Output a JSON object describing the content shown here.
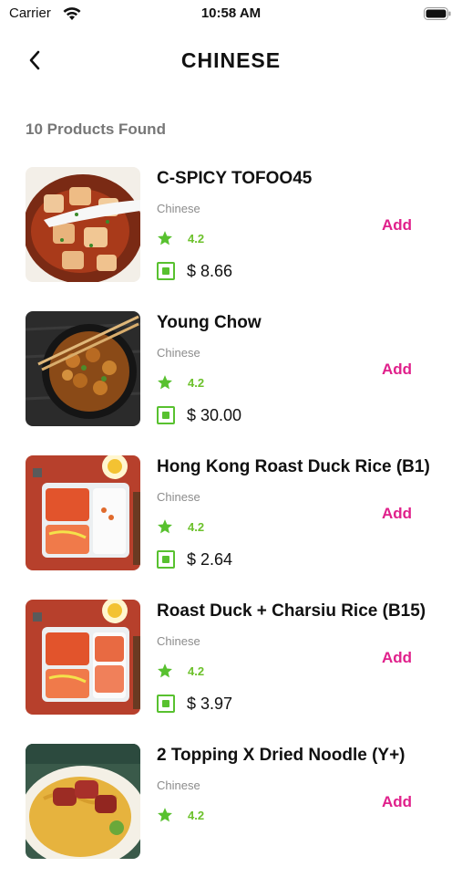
{
  "status_bar": {
    "carrier": "Carrier",
    "time": "10:58 AM"
  },
  "header": {
    "title": "CHINESE"
  },
  "results": {
    "count_text": "10 Products Found"
  },
  "products": [
    {
      "name": "C-SPICY TOFOO45",
      "category": "Chinese",
      "rating": "4.2",
      "price": "$ 8.66",
      "add_label": "Add"
    },
    {
      "name": "Young Chow",
      "category": "Chinese",
      "rating": "4.2",
      "price": "$ 30.00",
      "add_label": "Add"
    },
    {
      "name": "Hong Kong Roast Duck Rice (B1)",
      "category": "Chinese",
      "rating": "4.2",
      "price": "$ 2.64",
      "add_label": "Add"
    },
    {
      "name": "Roast Duck + Charsiu Rice (B15)",
      "category": "Chinese",
      "rating": "4.2",
      "price": "$ 3.97",
      "add_label": "Add"
    },
    {
      "name": "2 Topping X Dried Noodle (Y+)",
      "category": "Chinese",
      "rating": "4.2",
      "price": "",
      "add_label": "Add"
    }
  ],
  "colors": {
    "accent": "#e0208b",
    "rating_green": "#6cc12b",
    "veg_green": "#58c12f"
  }
}
